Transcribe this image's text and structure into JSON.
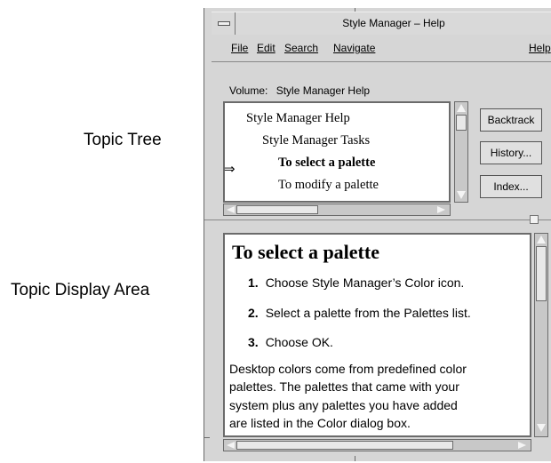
{
  "callouts": {
    "topic_tree": "Topic Tree",
    "topic_display_area": "Topic Display Area"
  },
  "window": {
    "title": "Style Manager – Help",
    "menu": [
      "File",
      "Edit",
      "Search",
      "Navigate",
      "Help"
    ]
  },
  "volume": {
    "label": "Volume:",
    "name": "Style Manager Help"
  },
  "topic_tree": {
    "current_marker": "⇒",
    "items": [
      {
        "label": "Style Manager Help",
        "level": 0,
        "current": false
      },
      {
        "label": "Style Manager Tasks",
        "level": 1,
        "current": false
      },
      {
        "label": "To select a palette",
        "level": 2,
        "current": true
      },
      {
        "label": "To modify a palette",
        "level": 2,
        "current": false
      }
    ]
  },
  "side_buttons": [
    "Backtrack",
    "History...",
    "Index..."
  ],
  "topic": {
    "title": "To select a palette",
    "steps": [
      {
        "num": "1.",
        "text": "Choose Style Manager’s Color icon."
      },
      {
        "num": "2.",
        "text": "Select a palette from the Palettes list."
      },
      {
        "num": "3.",
        "text": "Choose OK."
      }
    ],
    "paragraph_lines": [
      "Desktop colors come from predefined color",
      "palettes. The palettes that came with your",
      "system plus any palettes you have added",
      "are listed in the Color dialog box."
    ]
  },
  "icons": {
    "window_menu": "window-menu-icon",
    "current_topic": "arrow-right-icon",
    "scroll_up": "triangle-up-icon",
    "scroll_down": "triangle-down-icon",
    "scroll_left": "triangle-left-icon",
    "scroll_right": "triangle-right-icon"
  }
}
